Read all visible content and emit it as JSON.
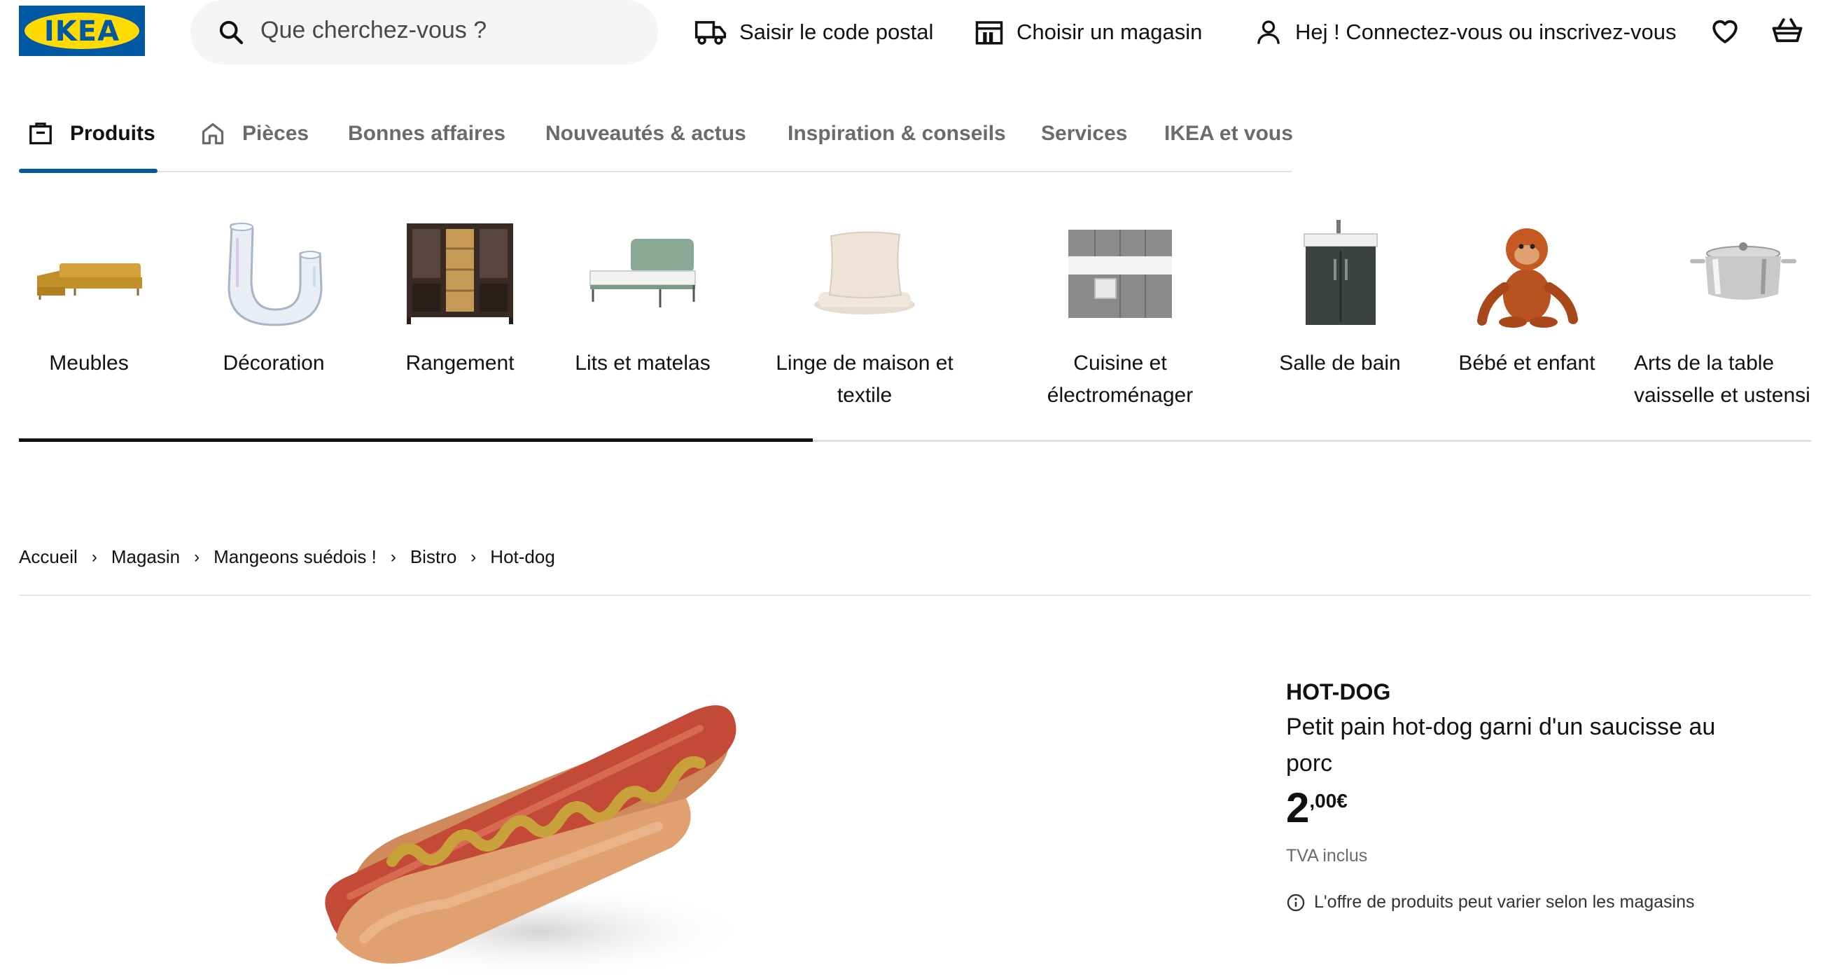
{
  "header": {
    "logo_text": "IKEA",
    "search_placeholder": "Que cherchez-vous ?",
    "postcode_label": "Saisir le code postal",
    "store_label": "Choisir un magasin",
    "account_label": "Hej ! Connectez-vous ou inscrivez-vous"
  },
  "nav": {
    "items": [
      {
        "label": "Produits",
        "icon": "product-box-icon",
        "active": true
      },
      {
        "label": "Pièces",
        "icon": "house-icon",
        "active": false
      },
      {
        "label": "Bonnes affaires",
        "active": false
      },
      {
        "label": "Nouveautés & actus",
        "active": false
      },
      {
        "label": "Inspiration & conseils",
        "active": false
      },
      {
        "label": "Services",
        "active": false
      },
      {
        "label": "IKEA et vous",
        "active": false
      }
    ]
  },
  "categories": [
    {
      "label": "Meubles",
      "icon": "sofa-image"
    },
    {
      "label": "Décoration",
      "icon": "vase-image"
    },
    {
      "label": "Rangement",
      "icon": "cabinet-image"
    },
    {
      "label": "Lits et matelas",
      "icon": "bed-image"
    },
    {
      "label": "Linge de maison et textile",
      "icon": "pillow-image"
    },
    {
      "label": "Cuisine et électroménager",
      "icon": "kitchen-image"
    },
    {
      "label": "Salle de bain",
      "icon": "bathroom-cabinet-image"
    },
    {
      "label": "Bébé et enfant",
      "icon": "plush-monkey-image"
    },
    {
      "label": "Arts de la table vaisselle et ustensiles",
      "icon": "pot-image"
    }
  ],
  "breadcrumb": [
    "Accueil",
    "Magasin",
    "Mangeons suédois !",
    "Bistro",
    "Hot-dog"
  ],
  "product": {
    "name": "HOT-DOG",
    "description": "Petit pain hot-dog garni d'un saucisse au porc",
    "price_int": "2",
    "price_dec": ",00€",
    "vat": "TVA inclus",
    "note": "L'offre de produits peut varier selon les magasins",
    "image": "hot-dog-image"
  },
  "colors": {
    "brand_blue": "#0058a3",
    "brand_yellow": "#ffdb00"
  }
}
